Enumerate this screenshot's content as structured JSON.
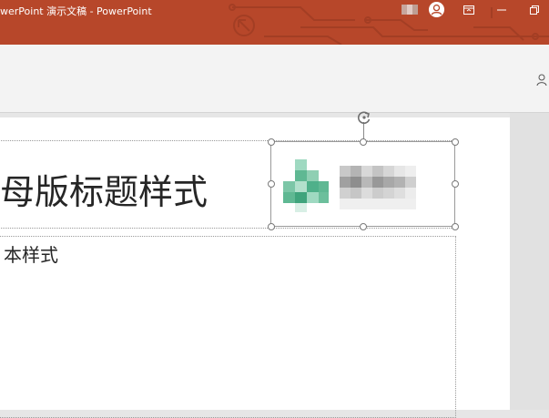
{
  "window": {
    "title": "werPoint 演示文稿 - PowerPoint",
    "brand_color": "#b7472a"
  },
  "titlebar_controls": {
    "account_icon": "user-avatar-icon",
    "ribbon_display_icon": "ribbon-display-options-icon",
    "minimize_icon": "minimize-icon",
    "restore_icon": "restore-icon"
  },
  "slide": {
    "title_placeholder": "母版标题样式",
    "body_placeholder": "本样式",
    "logo_icon": "blurred-logo-image"
  },
  "ribbon": {
    "share_icon": "share-person-icon"
  }
}
